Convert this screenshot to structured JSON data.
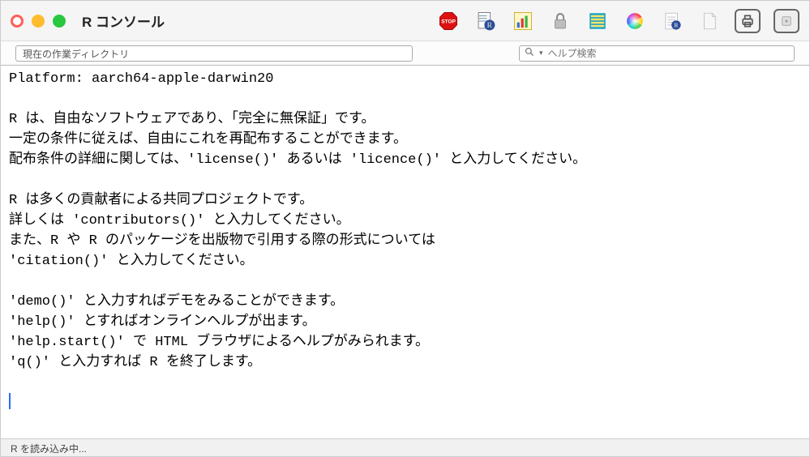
{
  "window": {
    "title": "R コンソール"
  },
  "toolbar": {
    "cwd_label": "現在の作業ディレクトリ",
    "search_placeholder": "ヘルプ検索"
  },
  "console": {
    "lines": [
      "Platform: aarch64-apple-darwin20",
      "",
      "R は、自由なソフトウェアであり、「完全に無保証」です。 ",
      "一定の条件に従えば、自由にこれを再配布することができます。 ",
      "配布条件の詳細に関しては、'license()' あるいは 'licence()' と入力してください。 ",
      "",
      "R は多くの貢献者による共同プロジェクトです。 ",
      "詳しくは 'contributors()' と入力してください。 ",
      "また、R や R のパッケージを出版物で引用する際の形式については ",
      "'citation()' と入力してください。 ",
      "",
      "'demo()' と入力すればデモをみることができます。 ",
      "'help()' とすればオンラインヘルプが出ます。 ",
      "'help.start()' で HTML ブラウザによるヘルプがみられます。 ",
      "'q()' と入力すれば R を終了します。 ",
      ""
    ]
  },
  "status": {
    "text": "R を読み込み中..."
  }
}
